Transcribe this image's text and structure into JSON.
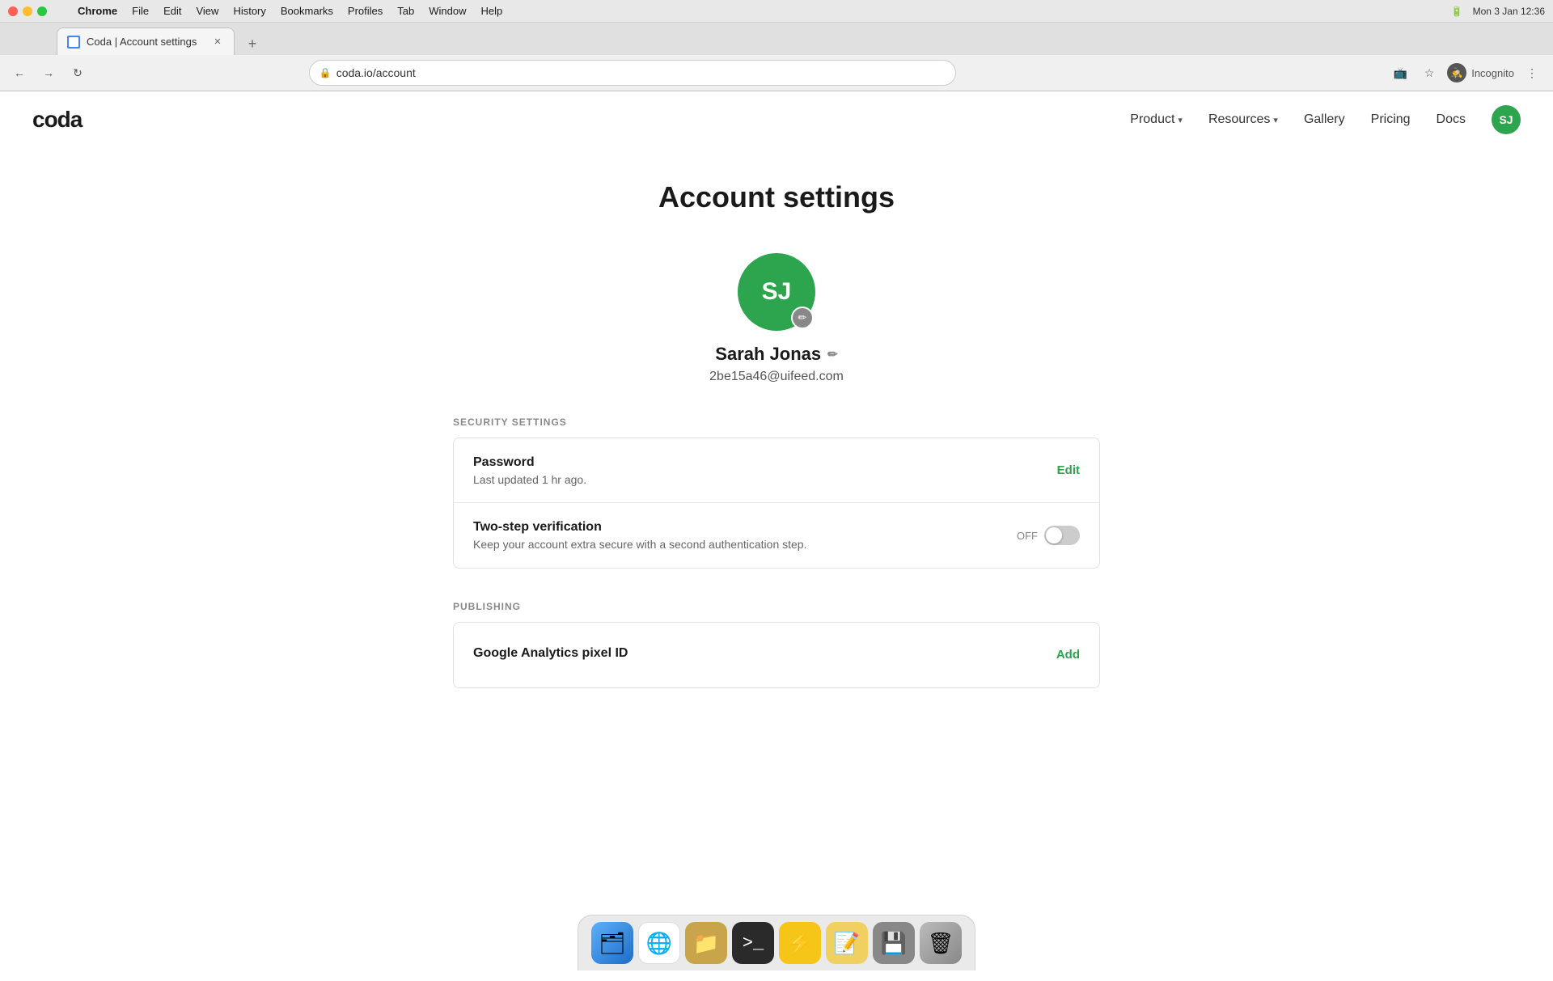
{
  "os": {
    "menu_items": [
      "Chrome",
      "File",
      "Edit",
      "View",
      "History",
      "Bookmarks",
      "Profiles",
      "Tab",
      "Window",
      "Help"
    ],
    "chrome_label": "Chrome",
    "time": "Mon 3 Jan  12:36",
    "battery": "🔋"
  },
  "browser": {
    "tab_title": "Coda | Account settings",
    "tab_url": "coda.io/account",
    "new_tab_label": "+",
    "incognito_label": "Incognito"
  },
  "nav": {
    "logo": "coda",
    "links": [
      {
        "label": "Product",
        "has_dropdown": true
      },
      {
        "label": "Resources",
        "has_dropdown": true
      },
      {
        "label": "Gallery",
        "has_dropdown": false
      },
      {
        "label": "Pricing",
        "has_dropdown": false
      },
      {
        "label": "Docs",
        "has_dropdown": false
      }
    ],
    "avatar_initials": "SJ"
  },
  "page": {
    "title": "Account settings",
    "user": {
      "initials": "SJ",
      "name": "Sarah Jonas",
      "email": "2be15a46@uifeed.com"
    },
    "security_section": {
      "header": "SECURITY SETTINGS",
      "rows": [
        {
          "title": "Password",
          "subtitle": "Last updated 1 hr ago.",
          "action_label": "Edit",
          "action_type": "link"
        },
        {
          "title": "Two-step verification",
          "subtitle": "Keep your account extra secure with a second authentication step.",
          "action_label": "OFF",
          "action_type": "toggle",
          "toggle_state": "off"
        }
      ]
    },
    "publishing_section": {
      "header": "PUBLISHING",
      "rows": [
        {
          "title": "Google Analytics pixel ID",
          "subtitle": "",
          "action_label": "Add",
          "action_type": "link"
        }
      ]
    }
  },
  "dock": {
    "items": [
      {
        "name": "finder",
        "emoji": "🗂"
      },
      {
        "name": "chrome",
        "emoji": "🌐"
      },
      {
        "name": "folder",
        "emoji": "📁"
      },
      {
        "name": "terminal",
        "emoji": "⬛"
      },
      {
        "name": "bolt",
        "emoji": "⚡"
      },
      {
        "name": "notes",
        "emoji": "📝"
      },
      {
        "name": "usb",
        "emoji": "💾"
      },
      {
        "name": "trash",
        "emoji": "🗑"
      }
    ]
  }
}
